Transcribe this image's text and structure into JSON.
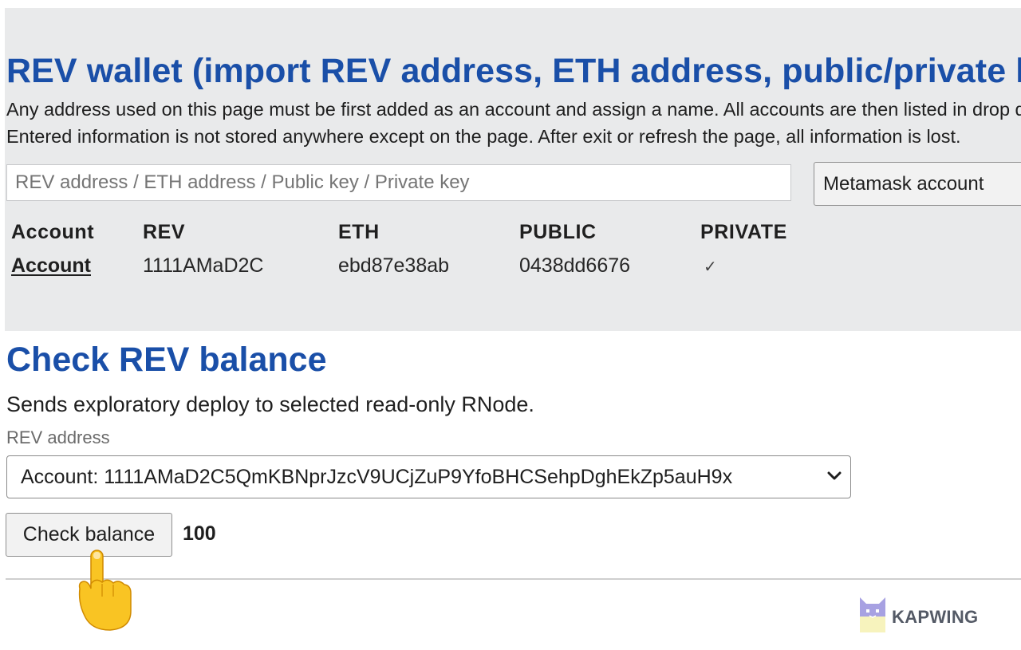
{
  "wallet": {
    "title": "REV wallet (import REV address, ETH address, public/private key)",
    "description_line1": "Any address used on this page must be first added as an account and assign a name. All accounts are then listed in drop down menus to select.",
    "description_line2": "Entered information is not stored anywhere except on the page. After exit or refresh the page, all information is lost.",
    "import_placeholder": "REV address / ETH address / Public key / Private key",
    "import_value": "",
    "metamask_button_label": "Metamask account",
    "table": {
      "headers": [
        "Account",
        "REV",
        "ETH",
        "PUBLIC",
        "PRIVATE"
      ],
      "rows": [
        {
          "account": "Account",
          "rev": "1111AMaD2C",
          "eth": "ebd87e38ab",
          "public": "0438dd6676",
          "private": "✓"
        }
      ]
    }
  },
  "check_balance": {
    "title": "Check REV balance",
    "description": "Sends exploratory deploy to selected read-only RNode.",
    "field_label": "REV address",
    "selected_option": "Account: 1111AMaD2C5QmKBNprJzcV9UCjZuP9YfoBHCSehpDghEkZp5auH9x",
    "button_label": "Check balance",
    "balance_value": "100"
  },
  "watermark": {
    "brand": "KAPWING"
  },
  "colors": {
    "heading_blue": "#1a4fa8",
    "panel_gray": "#e9eaeb",
    "button_gray": "#f2f2f2",
    "pointer_yellow": "#f9c423"
  },
  "icons": {
    "select_chevron": "chevron-down-icon",
    "pointer": "pointing-hand-icon",
    "logo": "kapwing-logo-icon"
  }
}
